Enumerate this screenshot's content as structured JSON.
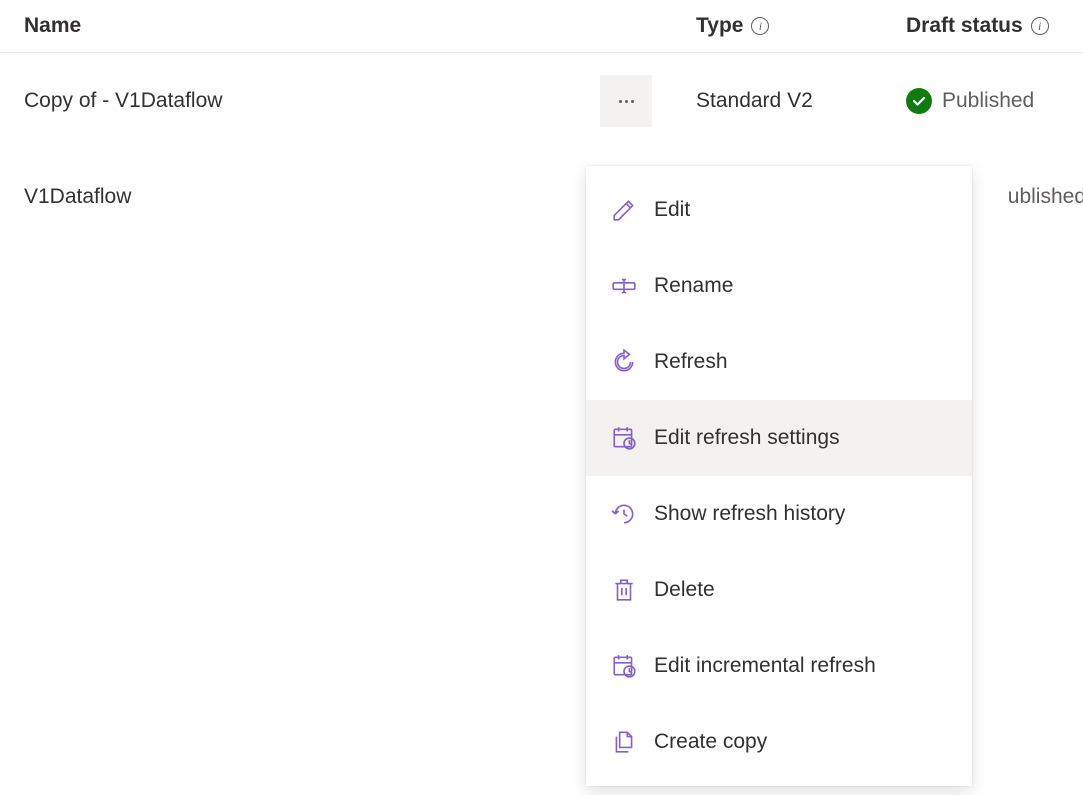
{
  "columns": {
    "name": "Name",
    "type": "Type",
    "status": "Draft status"
  },
  "rows": [
    {
      "name": "Copy of - V1Dataflow",
      "type": "Standard V2",
      "status": "Published",
      "show_actions": true
    },
    {
      "name": "V1Dataflow",
      "type": "",
      "status": "ublished",
      "show_actions": false
    }
  ],
  "menu": {
    "edit": "Edit",
    "rename": "Rename",
    "refresh": "Refresh",
    "edit_refresh_settings": "Edit refresh settings",
    "show_refresh_history": "Show refresh history",
    "delete": "Delete",
    "edit_incremental_refresh": "Edit incremental refresh",
    "create_copy": "Create copy"
  }
}
